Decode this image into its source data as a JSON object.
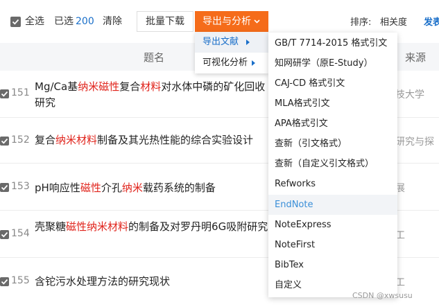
{
  "toolbar": {
    "select_all_label": "全选",
    "selected_label": "已选",
    "selected_count": "200",
    "clear_label": "清除",
    "batch_download_label": "批量下载",
    "export_label": "导出与分析",
    "sort_label": "排序:",
    "sort_option": "相关度",
    "sort_extra": "发表"
  },
  "export_submenu": {
    "items": [
      {
        "label": "导出文献"
      },
      {
        "label": "可视化分析"
      }
    ]
  },
  "format_menu": {
    "items": [
      {
        "label": "GB/T 7714-2015 格式引文"
      },
      {
        "label": "知网研学（原E-Study）"
      },
      {
        "label": "CAJ-CD 格式引文"
      },
      {
        "label": "MLA格式引文"
      },
      {
        "label": "APA格式引文"
      },
      {
        "label": "查新（引文格式）"
      },
      {
        "label": "查新（自定义引文格式）"
      },
      {
        "label": "Refworks"
      },
      {
        "label": "EndNote"
      },
      {
        "label": "NoteExpress"
      },
      {
        "label": "NoteFirst"
      },
      {
        "label": "BibTex"
      },
      {
        "label": "自定义"
      }
    ],
    "highlighted": "EndNote"
  },
  "table": {
    "header_title": "题名",
    "header_source": "来源",
    "rows": [
      {
        "num": "151",
        "title_parts": [
          [
            "Mg/Ca基",
            false
          ],
          [
            "纳米磁性",
            true
          ],
          [
            "复合",
            false
          ],
          [
            "材料",
            true
          ],
          [
            "对水体中磷的矿化回收研究",
            false
          ]
        ],
        "source": "技大学"
      },
      {
        "num": "152",
        "title_parts": [
          [
            "复合",
            false
          ],
          [
            "纳米材料",
            true
          ],
          [
            "制备及其光热性能的综合实验设计",
            false
          ]
        ],
        "source": "研究与探"
      },
      {
        "num": "153",
        "title_parts": [
          [
            "pH响应性",
            false
          ],
          [
            "磁性",
            true
          ],
          [
            "介孔",
            false
          ],
          [
            "纳米",
            true
          ],
          [
            "载药系统的制备",
            false
          ]
        ],
        "source": "展"
      },
      {
        "num": "154",
        "title_parts": [
          [
            "壳聚糖",
            false
          ],
          [
            "磁性纳米材料",
            true
          ],
          [
            "的制备及对罗丹明6G吸附研究",
            false
          ]
        ],
        "source": "工"
      },
      {
        "num": "155",
        "title_parts": [
          [
            "含铊污水处理方法的研究现状",
            false
          ]
        ],
        "source": "工"
      }
    ]
  },
  "watermark": "CSDN @xwsusu"
}
